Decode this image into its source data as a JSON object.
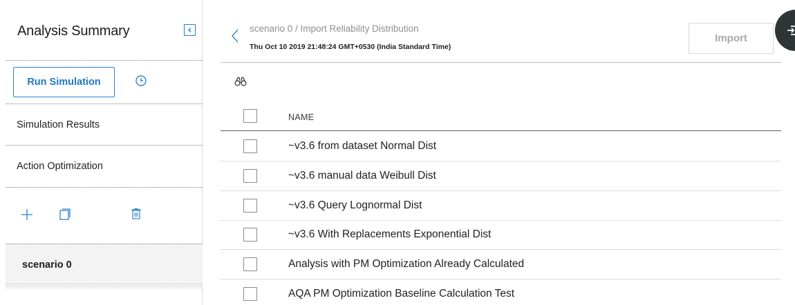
{
  "sidebar": {
    "title": "Analysis Summary",
    "run_simulation_label": "Run Simulation",
    "items": [
      {
        "label": "Simulation Results"
      },
      {
        "label": "Action Optimization"
      }
    ],
    "scenario": {
      "label": "scenario 0"
    }
  },
  "header": {
    "breadcrumb": "scenario 0 / Import Reliability Distribution",
    "timestamp": "Thu Oct 10 2019 21:48:24 GMT+0530 (India Standard Time)",
    "import_label": "Import"
  },
  "table": {
    "columns": [
      "NAME"
    ],
    "rows": [
      {
        "name": "~v3.6 from dataset Normal Dist"
      },
      {
        "name": "~v3.6 manual data Weibull Dist"
      },
      {
        "name": "~v3.6 Query Lognormal Dist"
      },
      {
        "name": "~v3.6 With Replacements Exponential Dist"
      },
      {
        "name": "Analysis with PM Optimization Already Calculated"
      },
      {
        "name": "AQA PM Optimization Baseline Calculation Test"
      }
    ]
  },
  "icons": {
    "collapse": "collapse-panel-icon",
    "history": "clock-icon",
    "add": "plus-icon",
    "copy": "copy-icon",
    "delete": "trash-icon",
    "back": "chevron-left-icon",
    "search": "binoculars-icon",
    "fab": "sign-in-icon"
  },
  "colors": {
    "accent": "#1f78c1",
    "fab_bg": "#2f3437",
    "selected_bg": "#f3f3f3"
  }
}
